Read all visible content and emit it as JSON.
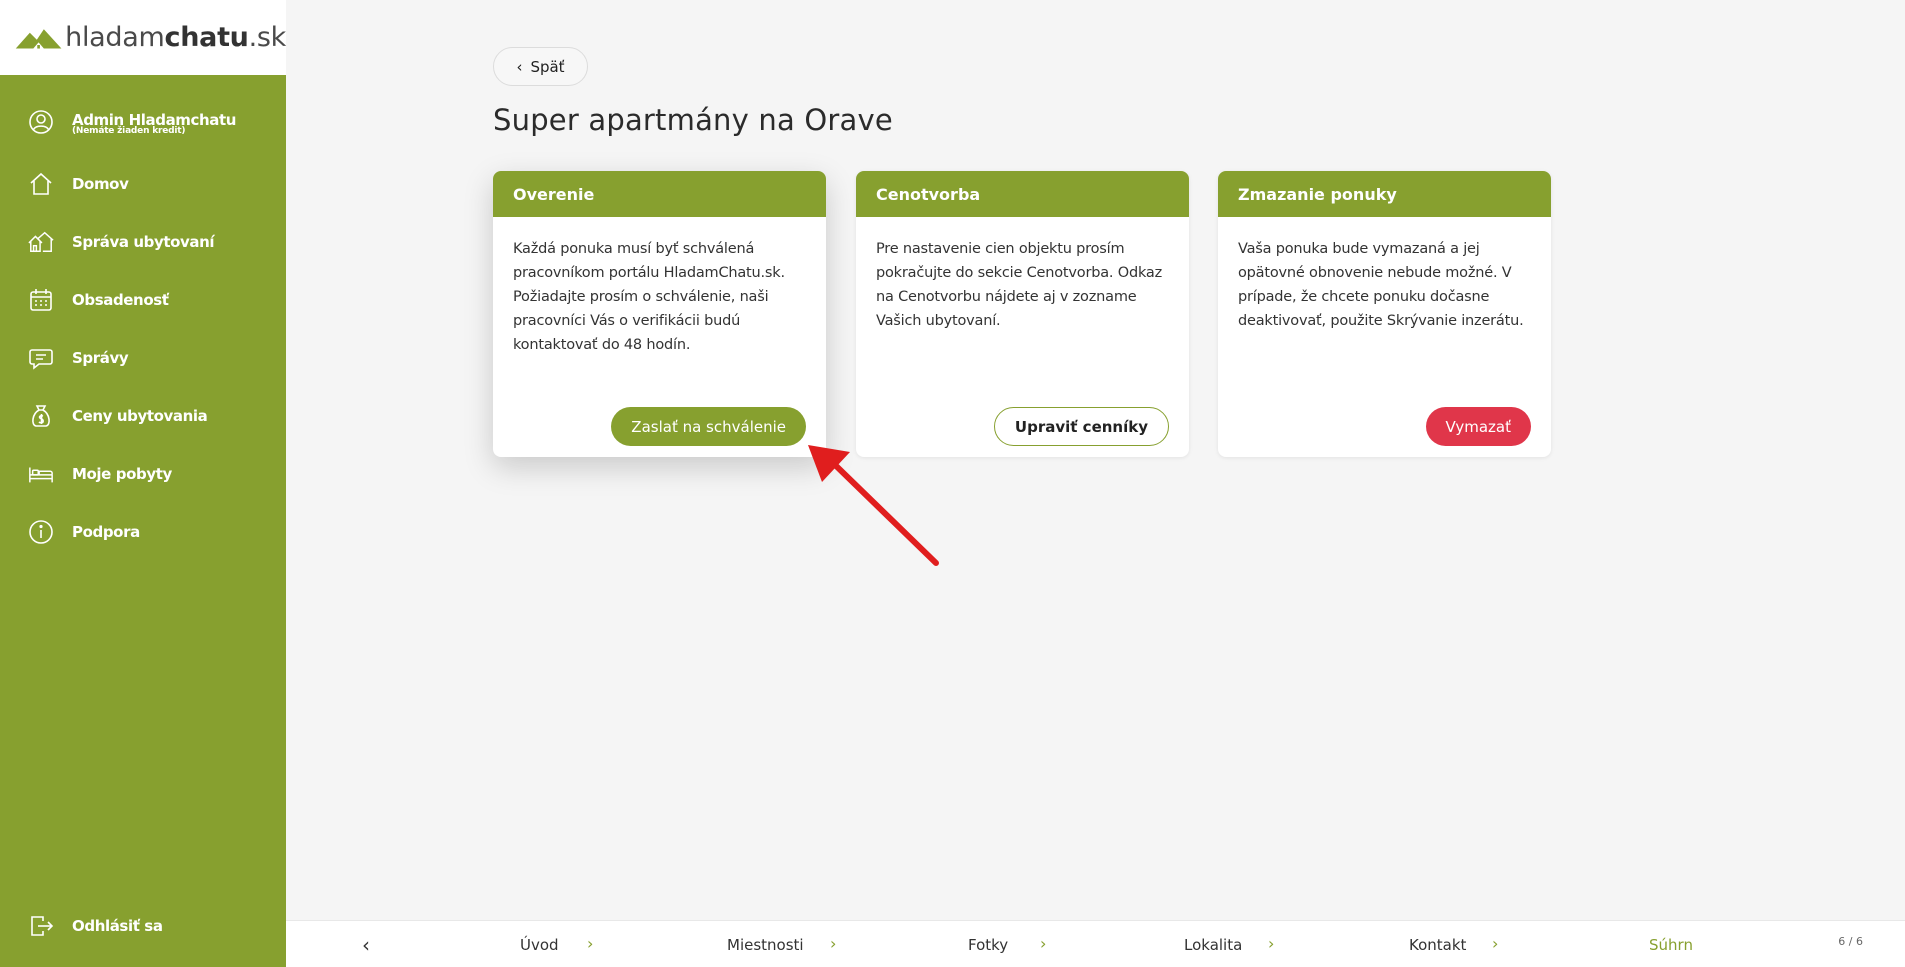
{
  "logo": {
    "part1": "hladam",
    "part2": "chatu",
    "part3": ".sk"
  },
  "user": {
    "name": "Admin Hladamchatu",
    "credit": "(Nemáte žiaden kredit)"
  },
  "menu": [
    {
      "label": "Domov",
      "icon": "home-icon"
    },
    {
      "label": "Správa ubytovaní",
      "icon": "cabins-icon"
    },
    {
      "label": "Obsadenosť",
      "icon": "calendar-icon"
    },
    {
      "label": "Správy",
      "icon": "message-icon"
    },
    {
      "label": "Ceny ubytovania",
      "icon": "money-bag-icon"
    },
    {
      "label": "Moje pobyty",
      "icon": "bed-icon"
    },
    {
      "label": "Podpora",
      "icon": "info-icon"
    }
  ],
  "logout": {
    "label": "Odhlásiť sa"
  },
  "back": {
    "label": "Späť"
  },
  "page": {
    "title": "Super apartmány na Orave"
  },
  "cards": [
    {
      "header": "Overenie",
      "body": "Každá ponuka musí byť schválená pracovníkom portálu HladamChatu.sk. Požiadajte prosím o schválenie, naši pracovníci Vás o verifikácii budú kontaktovať do 48 hodín.",
      "button": "Zaslať na schválenie"
    },
    {
      "header": "Cenotvorba",
      "body": "Pre nastavenie cien objektu prosím pokračujte do sekcie Cenotvorba. Odkaz na Cenotvorbu nájdete aj v zozname Vašich ubytovaní.",
      "button": "Upraviť cenníky"
    },
    {
      "header": "Zmazanie ponuky",
      "body": "Vaša ponuka bude vymazaná a jej opätovné obnovenie nebude možné. V prípade, že chcete ponuku dočasne deaktivovať, použite Skrývanie inzerátu.",
      "button": "Vymazať"
    }
  ],
  "steps": [
    "Úvod",
    "Miestnosti",
    "Fotky",
    "Lokalita",
    "Kontakt",
    "Súhrn"
  ],
  "pager": {
    "text": "6 / 6"
  },
  "colors": {
    "brand": "#87a02f",
    "danger": "#e0364a",
    "annotation": "#e01e1e"
  }
}
